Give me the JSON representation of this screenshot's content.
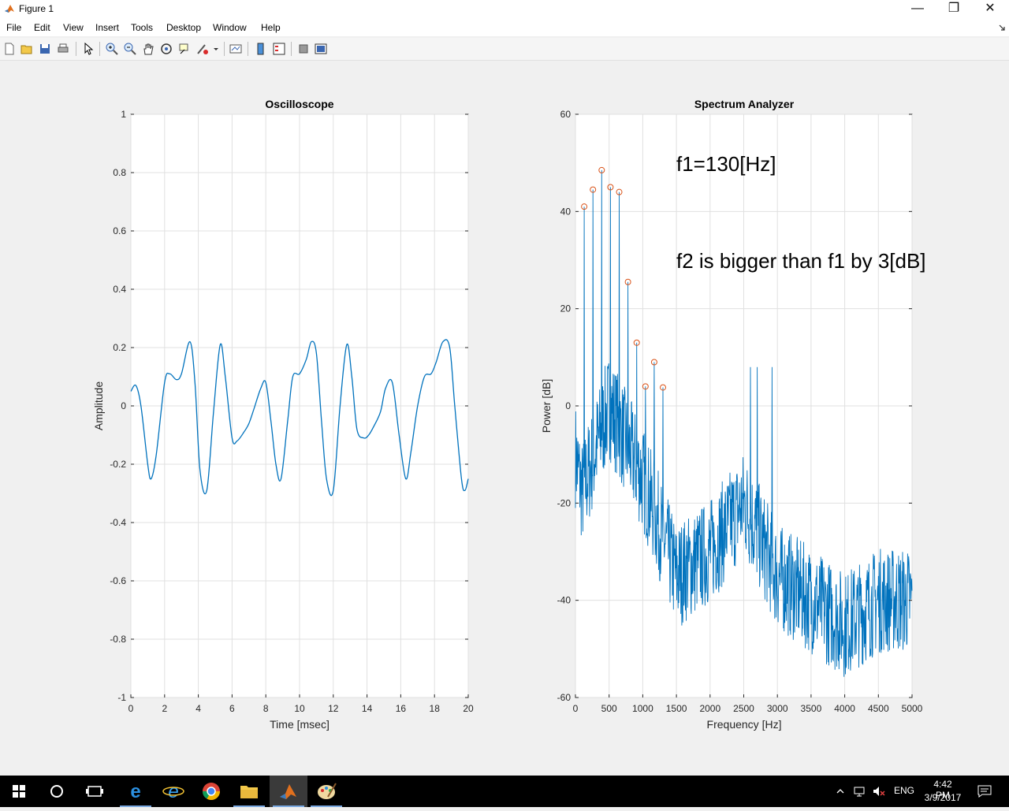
{
  "window": {
    "title": "Figure 1",
    "minimize_glyph": "—",
    "restore_glyph": "❐",
    "close_glyph": "✕"
  },
  "menu": [
    "File",
    "Edit",
    "View",
    "Insert",
    "Tools",
    "Desktop",
    "Window",
    "Help"
  ],
  "toolbar_icons": [
    "new-figure-icon",
    "open-icon",
    "save-icon",
    "print-icon",
    "pointer-icon",
    "zoom-in-icon",
    "zoom-out-icon",
    "pan-icon",
    "rotate-3d-icon",
    "data-cursor-icon",
    "brush-icon",
    "link-plot-icon",
    "colorbar-icon",
    "legend-icon",
    "hide-plot-tools-icon",
    "show-plot-tools-icon"
  ],
  "colors": {
    "line": "#0072bd",
    "marker": "#d95319",
    "axes_bg": "#ffffff",
    "grid": "#e0e0e0"
  },
  "chart_data": [
    {
      "type": "line",
      "title": "Oscilloscope",
      "xlabel": "Time [msec]",
      "ylabel": "Amplitude",
      "xlim": [
        0,
        20
      ],
      "ylim": [
        -1,
        1
      ],
      "xticks": [
        "0",
        "2",
        "4",
        "6",
        "8",
        "10",
        "12",
        "14",
        "16",
        "18",
        "20"
      ],
      "yticks": [
        "1",
        "0.8",
        "0.6",
        "0.4",
        "0.2",
        "0",
        "-0.2",
        "-0.4",
        "-0.6",
        "-0.8",
        "-1"
      ],
      "grid": true,
      "series": [
        {
          "x": [
            0,
            0.3,
            0.6,
            1.0,
            1.2,
            1.5,
            2.0,
            2.3,
            2.7,
            3.0,
            3.5,
            3.8,
            4.1,
            4.5,
            4.9,
            5.3,
            5.6,
            6.0,
            6.3,
            6.7,
            7.0,
            7.3,
            7.7,
            8.0,
            8.3,
            8.6,
            8.9,
            9.3,
            9.6,
            10.0,
            10.4,
            10.7,
            11.0,
            11.3,
            11.6,
            12.0,
            12.4,
            12.8,
            13.1,
            13.4,
            13.8,
            14.1,
            14.4,
            14.8,
            15.1,
            15.5,
            15.9,
            16.3,
            16.6,
            17.0,
            17.4,
            17.8,
            18.1,
            18.5,
            18.9,
            19.2,
            19.6,
            19.8,
            20.0
          ],
          "y": [
            0.05,
            0.07,
            0.0,
            -0.2,
            -0.25,
            -0.17,
            0.08,
            0.11,
            0.09,
            0.11,
            0.22,
            0.08,
            -0.22,
            -0.29,
            -0.02,
            0.21,
            0.1,
            -0.11,
            -0.12,
            -0.09,
            -0.06,
            -0.01,
            0.06,
            0.08,
            -0.05,
            -0.2,
            -0.25,
            -0.05,
            0.1,
            0.11,
            0.16,
            0.22,
            0.18,
            -0.05,
            -0.25,
            -0.29,
            0.0,
            0.21,
            0.1,
            -0.08,
            -0.11,
            -0.1,
            -0.07,
            -0.02,
            0.06,
            0.08,
            -0.1,
            -0.25,
            -0.16,
            0.0,
            0.1,
            0.11,
            0.15,
            0.22,
            0.2,
            0.0,
            -0.25,
            -0.29,
            -0.25
          ]
        }
      ]
    },
    {
      "type": "line",
      "title": "Spectrum Analyzer",
      "xlabel": "Frequency [Hz]",
      "ylabel": "Power [dB]",
      "xlim": [
        0,
        5000
      ],
      "ylim": [
        -60,
        60
      ],
      "xticks": [
        "0",
        "500",
        "1000",
        "1500",
        "2000",
        "2500",
        "3000",
        "3500",
        "4000",
        "4500",
        "5000"
      ],
      "yticks": [
        "60",
        "40",
        "20",
        "0",
        "-20",
        "-40",
        "-60"
      ],
      "grid": true,
      "annotations": [
        "f1=130[Hz]",
        "f2 is bigger than f1 by 3[dB]"
      ],
      "peaks": {
        "x": [
          130,
          260,
          390,
          520,
          650,
          780,
          910,
          1040,
          1170,
          1300
        ],
        "y": [
          41,
          44.5,
          48.5,
          45,
          44,
          25.5,
          13,
          4,
          9,
          3.8
        ]
      },
      "series": [
        {
          "x": [
            0,
            100,
            500,
            1000,
            1500,
            2000,
            2500,
            3000,
            3500,
            4000,
            4500,
            5000
          ],
          "y": [
            -10,
            -18,
            0,
            -15,
            -35,
            -30,
            -20,
            -35,
            -40,
            -45,
            -40,
            -40
          ]
        }
      ]
    }
  ],
  "taskbar": {
    "icons": [
      "windows-start-icon",
      "search-icon",
      "task-view-icon",
      "edge-icon",
      "internet-explorer-icon",
      "chrome-icon",
      "file-explorer-icon",
      "matlab-icon",
      "paint-icon"
    ],
    "language": "ENG",
    "time": "4:42 PM",
    "date": "3/9/2017"
  }
}
